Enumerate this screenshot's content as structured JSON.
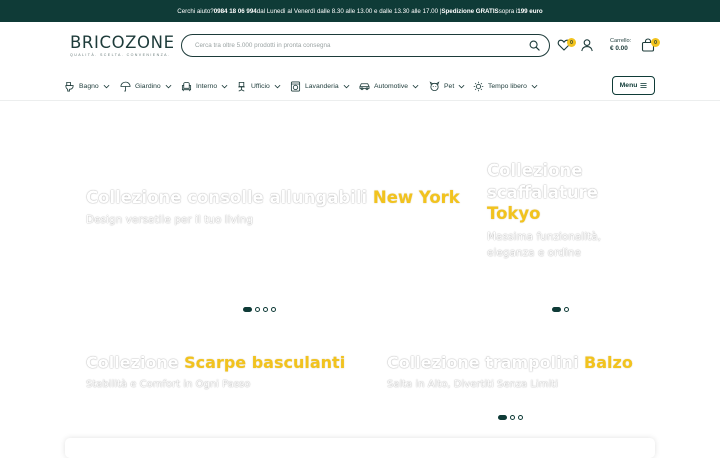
{
  "topbar": {
    "help_prefix": "Cerchi aiuto? ",
    "phone": "0984 18 06 994",
    "hours": " dal Lunedì al Venerdì dalle 8.30 alle 13.00 e dalle 13.30 alle 17.00 | ",
    "shipping_label": "Spedizione GRATIS",
    "shipping_mid": " sopra i ",
    "shipping_threshold": "199 euro"
  },
  "logo": {
    "name": "BRICOZONE",
    "tagline": "QUALITÀ. SCELTA. CONVENIENZA."
  },
  "search": {
    "placeholder": "Cerca tra oltre 5.000 prodotti in pronta consegna",
    "value": ""
  },
  "header": {
    "wishlist_count": "0",
    "cart_label": "Carrello:",
    "cart_amount": "€ 0.00",
    "cart_count": "0"
  },
  "nav": {
    "items": [
      {
        "label": "Bagno",
        "icon": "toilet-icon"
      },
      {
        "label": "Giardino",
        "icon": "umbrella-icon"
      },
      {
        "label": "Interno",
        "icon": "armchair-icon"
      },
      {
        "label": "Ufficio",
        "icon": "office-chair-icon"
      },
      {
        "label": "Lavanderia",
        "icon": "washing-machine-icon"
      },
      {
        "label": "Automotive",
        "icon": "car-icon"
      },
      {
        "label": "Pet",
        "icon": "dog-icon"
      },
      {
        "label": "Tempo libero",
        "icon": "sun-icon"
      }
    ],
    "menu_label": "Menu"
  },
  "slides": {
    "main": {
      "title": "Collezione consolle allungabili ",
      "highlight": "New York",
      "subtitle": "Design versatile per il tuo living"
    },
    "side": {
      "title_1": "Collezione",
      "title_2": "scaffalature",
      "highlight": "Tokyo",
      "subtitle_1": "Massima funzionalità,",
      "subtitle_2": "eleganza e ordine"
    },
    "bottom_left": {
      "title": "Collezione ",
      "highlight": "Scarpe basculanti",
      "subtitle": "Stabilità e Comfort in Ogni Passo"
    },
    "bottom_right": {
      "title": "Collezione trampolini ",
      "highlight": "Balzo",
      "subtitle": "Salta in Alto, Divertiti Senza Limiti"
    }
  },
  "colors": {
    "brand": "#0f3b37",
    "accent": "#f2c31e"
  }
}
